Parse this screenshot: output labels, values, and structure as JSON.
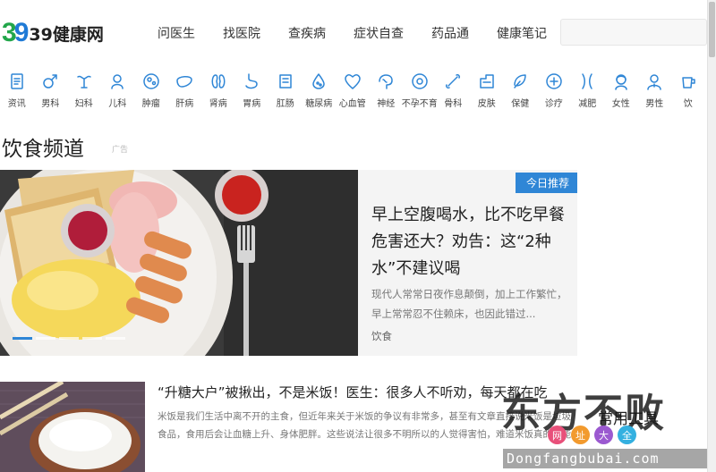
{
  "site": {
    "logo_mark": "39",
    "logo_text": "39健康网"
  },
  "nav": [
    "问医生",
    "找医院",
    "查疾病",
    "症状自查",
    "药品通",
    "健康笔记"
  ],
  "search": {
    "placeholder": ""
  },
  "categories": [
    {
      "label": "资讯",
      "icon": "news-icon"
    },
    {
      "label": "男科",
      "icon": "male-icon"
    },
    {
      "label": "妇科",
      "icon": "uterus-icon"
    },
    {
      "label": "儿科",
      "icon": "baby-icon"
    },
    {
      "label": "肿瘤",
      "icon": "cell-icon"
    },
    {
      "label": "肝病",
      "icon": "liver-icon"
    },
    {
      "label": "肾病",
      "icon": "kidney-icon"
    },
    {
      "label": "胃病",
      "icon": "stomach-icon"
    },
    {
      "label": "肛肠",
      "icon": "intestine-icon"
    },
    {
      "label": "糖尿病",
      "icon": "drop-icon"
    },
    {
      "label": "心血管",
      "icon": "heart-icon"
    },
    {
      "label": "神经",
      "icon": "brain-icon"
    },
    {
      "label": "不孕不育",
      "icon": "egg-icon"
    },
    {
      "label": "骨科",
      "icon": "bone-icon"
    },
    {
      "label": "皮肤",
      "icon": "skin-icon"
    },
    {
      "label": "保健",
      "icon": "care-icon"
    },
    {
      "label": "诊疗",
      "icon": "medical-cross-icon"
    },
    {
      "label": "减肥",
      "icon": "waist-icon"
    },
    {
      "label": "女性",
      "icon": "female-icon"
    },
    {
      "label": "男性",
      "icon": "man-icon"
    },
    {
      "label": "饮",
      "icon": "cup-icon"
    }
  ],
  "section": {
    "title": "饮食频道",
    "ad_label": "广告"
  },
  "feature": {
    "badge": "今日推荐",
    "title": "早上空腹喝水，比不吃早餐危害还大？劝告：这“2种水”不建议喝",
    "desc": "现代人常常日夜作息颠倒，加上工作繁忙，早上常常忍不住赖床，也因此错过...",
    "category": "饮食",
    "slides": 5
  },
  "article": {
    "title": "“升糖大户”被揪出，不是米饭！医生：很多人不听劝，每天都在吃",
    "desc": "米饭是我们生活中离不开的主食，但近年来关于米饭的争议有非常多，甚至有文章直接说米饭是垃圾食品，食用后会让血糖上升、身体肥胖。这些说法让很多不明所以的人觉得害怕，难道米饭真的不能吃吗"
  },
  "tools": {
    "title": "常用工具"
  },
  "watermark": {
    "text": "东方不败",
    "seals": [
      "网",
      "址",
      "大",
      "全"
    ],
    "domain": "Dongfangbubai.com"
  },
  "colors": {
    "accent": "#2f86d6",
    "logo_green": "#22a64a",
    "logo_blue": "#1f7ad6"
  }
}
